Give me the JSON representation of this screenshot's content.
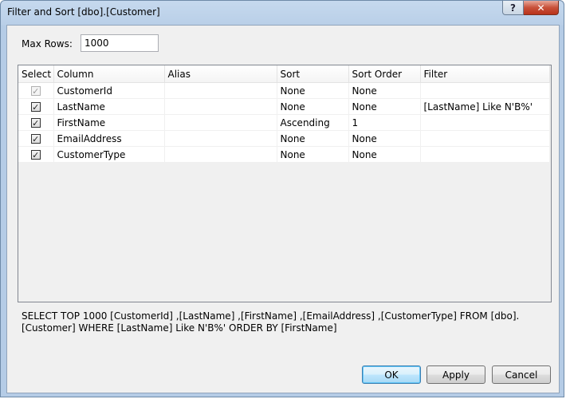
{
  "window": {
    "title": "Filter and Sort [dbo].[Customer]"
  },
  "title_buttons": {
    "help": "?",
    "close": "✕"
  },
  "max_rows": {
    "label": "Max Rows:",
    "value": "1000"
  },
  "grid": {
    "columns": [
      "Select",
      "Column",
      "Alias",
      "Sort",
      "Sort Order",
      "Filter"
    ],
    "rows": [
      {
        "selected": true,
        "disabled": true,
        "column": "CustomerId",
        "alias": "",
        "sort": "None",
        "sort_order": "None",
        "filter": ""
      },
      {
        "selected": true,
        "disabled": false,
        "column": "LastName",
        "alias": "",
        "sort": "None",
        "sort_order": "None",
        "filter": "[LastName] Like N'B%'"
      },
      {
        "selected": true,
        "disabled": false,
        "column": "FirstName",
        "alias": "",
        "sort": "Ascending",
        "sort_order": "1",
        "filter": ""
      },
      {
        "selected": true,
        "disabled": false,
        "column": "EmailAddress",
        "alias": "",
        "sort": "None",
        "sort_order": "None",
        "filter": ""
      },
      {
        "selected": true,
        "disabled": false,
        "column": "CustomerType",
        "alias": "",
        "sort": "None",
        "sort_order": "None",
        "filter": ""
      }
    ]
  },
  "sql_preview": "SELECT TOP 1000 [CustomerId] ,[LastName] ,[FirstName] ,[EmailAddress] ,[CustomerType] FROM [dbo].[Customer] WHERE [LastName] Like N'B%' ORDER BY [FirstName]",
  "buttons": {
    "ok": "OK",
    "apply": "Apply",
    "cancel": "Cancel"
  }
}
